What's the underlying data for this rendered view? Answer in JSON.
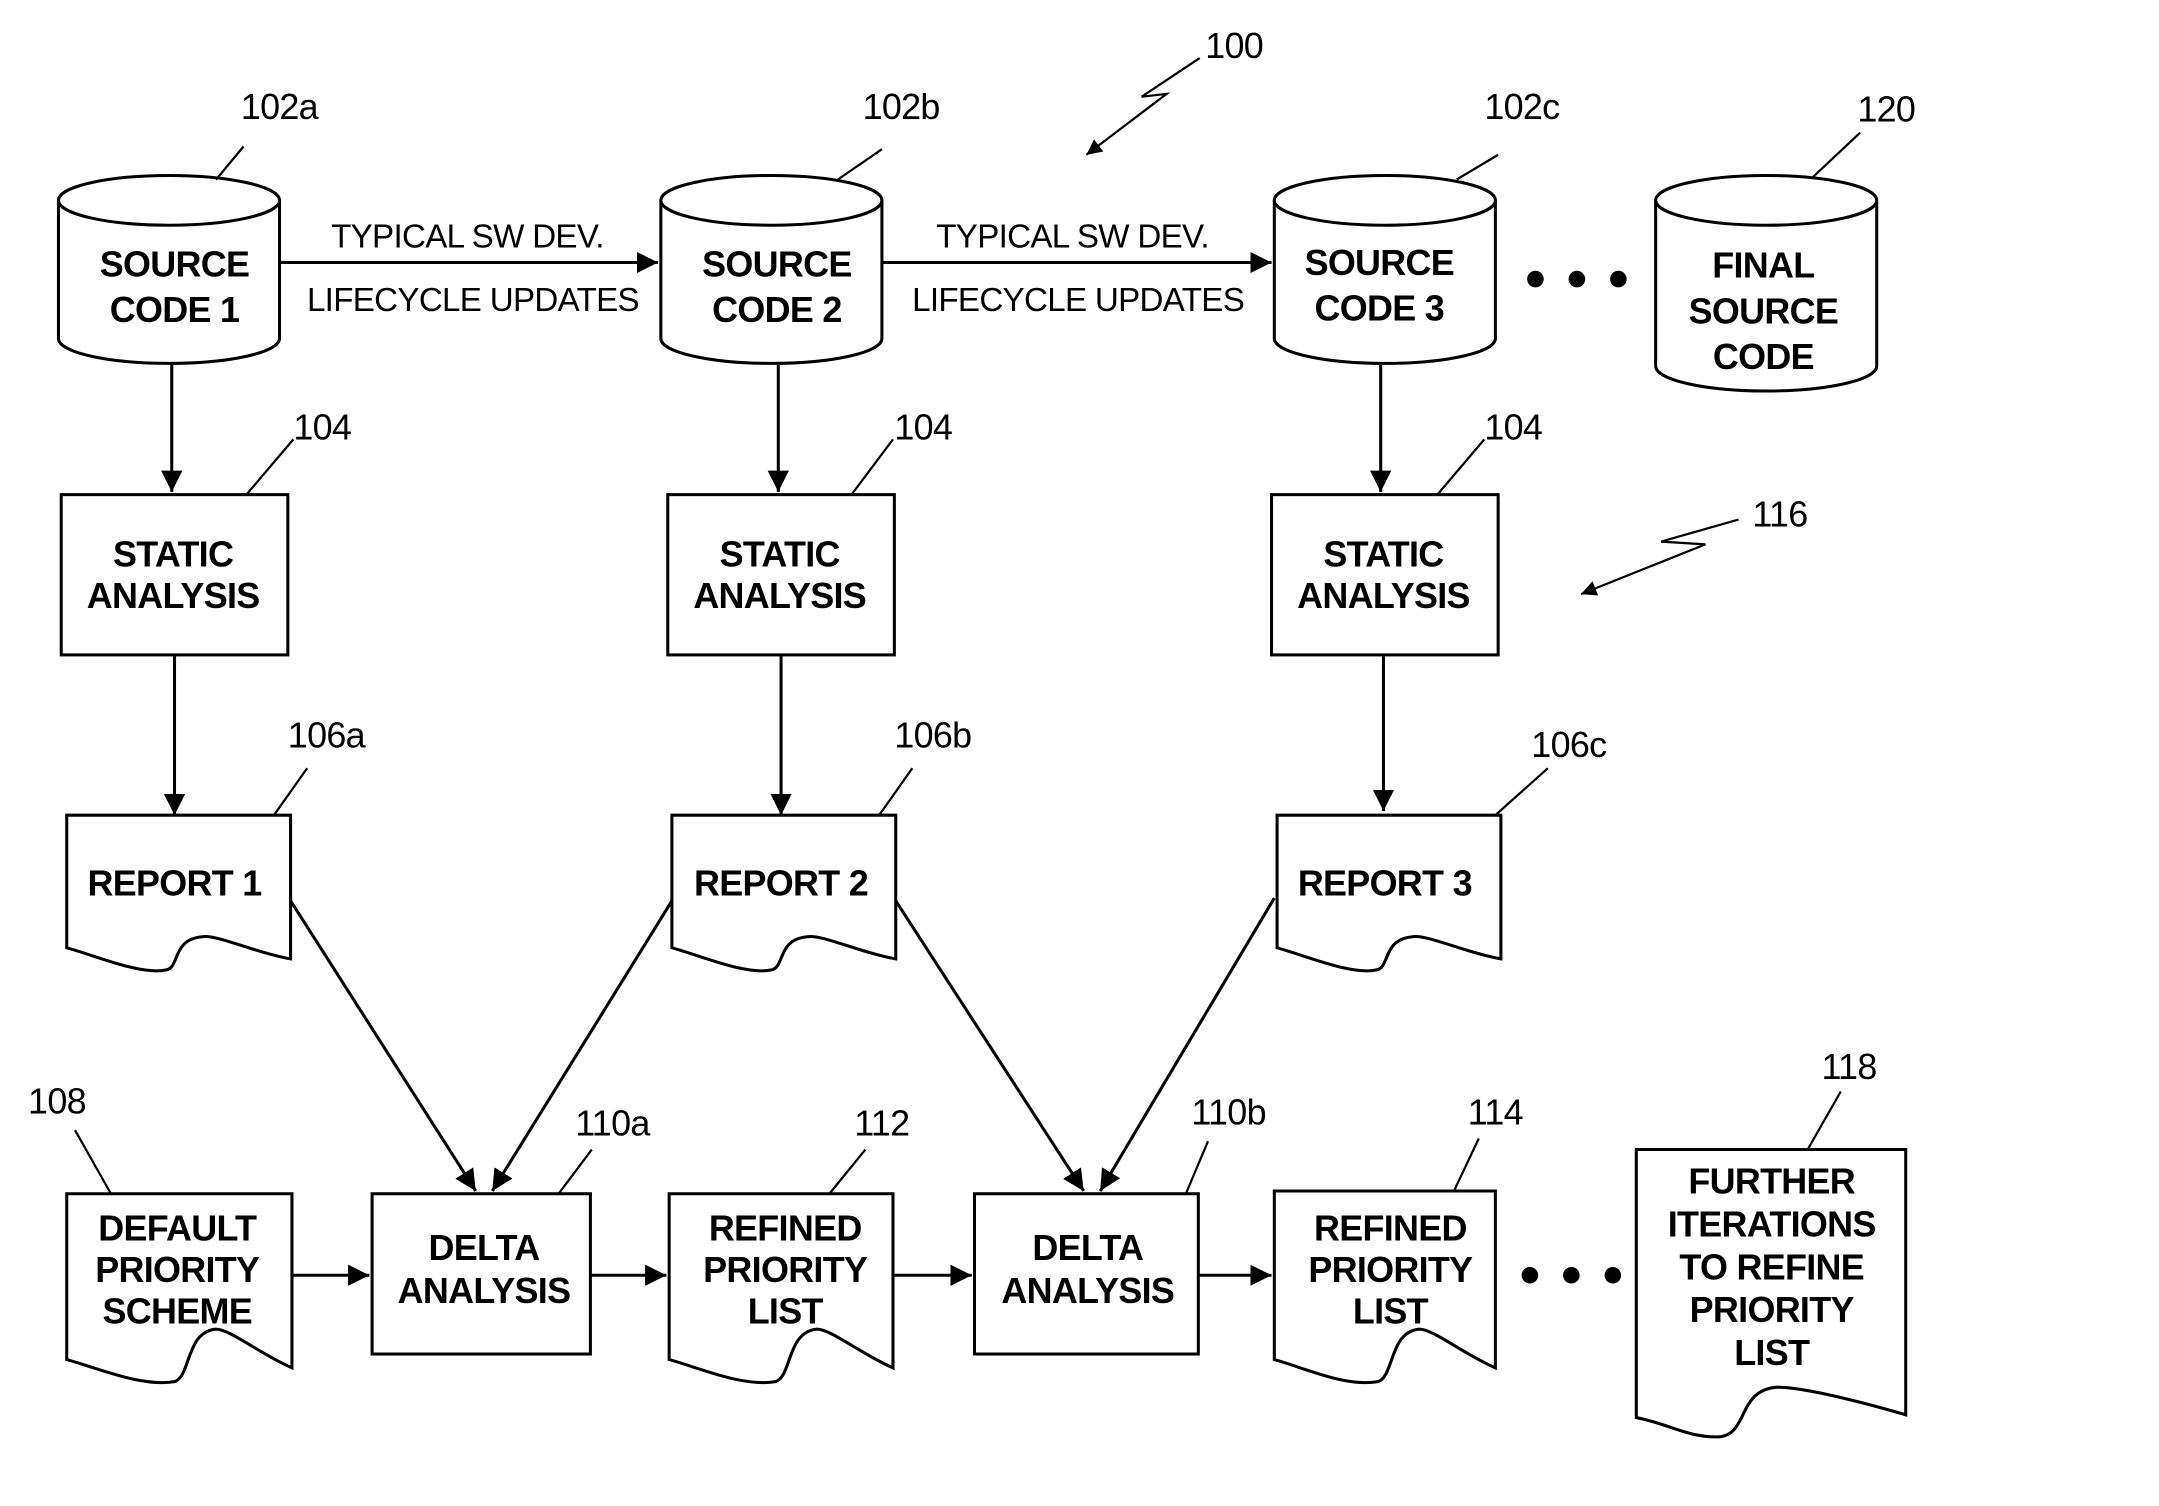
{
  "figure_ref": "100",
  "group_ref": "116",
  "source_stores": [
    {
      "ref": "102a",
      "lines": [
        "SOURCE",
        "CODE 1"
      ]
    },
    {
      "ref": "102b",
      "lines": [
        "SOURCE",
        "CODE 2"
      ]
    },
    {
      "ref": "102c",
      "lines": [
        "SOURCE",
        "CODE 3"
      ]
    },
    {
      "ref": "120",
      "lines": [
        "FINAL",
        "SOURCE",
        "CODE"
      ]
    }
  ],
  "lifecycle_edges": [
    {
      "lines": [
        "TYPICAL SW DEV.",
        "LIFECYCLE UPDATES"
      ]
    },
    {
      "lines": [
        "TYPICAL SW DEV.",
        "LIFECYCLE UPDATES"
      ]
    }
  ],
  "static_analysis": [
    {
      "ref": "104",
      "lines": [
        "STATIC",
        "ANALYSIS"
      ]
    },
    {
      "ref": "104",
      "lines": [
        "STATIC",
        "ANALYSIS"
      ]
    },
    {
      "ref": "104",
      "lines": [
        "STATIC",
        "ANALYSIS"
      ]
    }
  ],
  "reports": [
    {
      "ref": "106a",
      "label": "REPORT 1"
    },
    {
      "ref": "106b",
      "label": "REPORT 2"
    },
    {
      "ref": "106c",
      "label": "REPORT 3"
    }
  ],
  "bottom_row": {
    "default_priority": {
      "ref": "108",
      "lines": [
        "DEFAULT",
        "PRIORITY",
        "SCHEME"
      ]
    },
    "delta_a": {
      "ref": "110a",
      "lines": [
        "DELTA",
        "ANALYSIS"
      ]
    },
    "refined_a": {
      "ref": "112",
      "lines": [
        "REFINED",
        "PRIORITY",
        "LIST"
      ]
    },
    "delta_b": {
      "ref": "110b",
      "lines": [
        "DELTA",
        "ANALYSIS"
      ]
    },
    "refined_b": {
      "ref": "114",
      "lines": [
        "REFINED",
        "PRIORITY",
        "LIST"
      ]
    },
    "further": {
      "ref": "118",
      "lines": [
        "FURTHER",
        "ITERATIONS",
        "TO REFINE",
        "PRIORITY",
        "LIST"
      ]
    }
  },
  "ellipsis_top": "• • •",
  "ellipsis_bottom": "• • •"
}
